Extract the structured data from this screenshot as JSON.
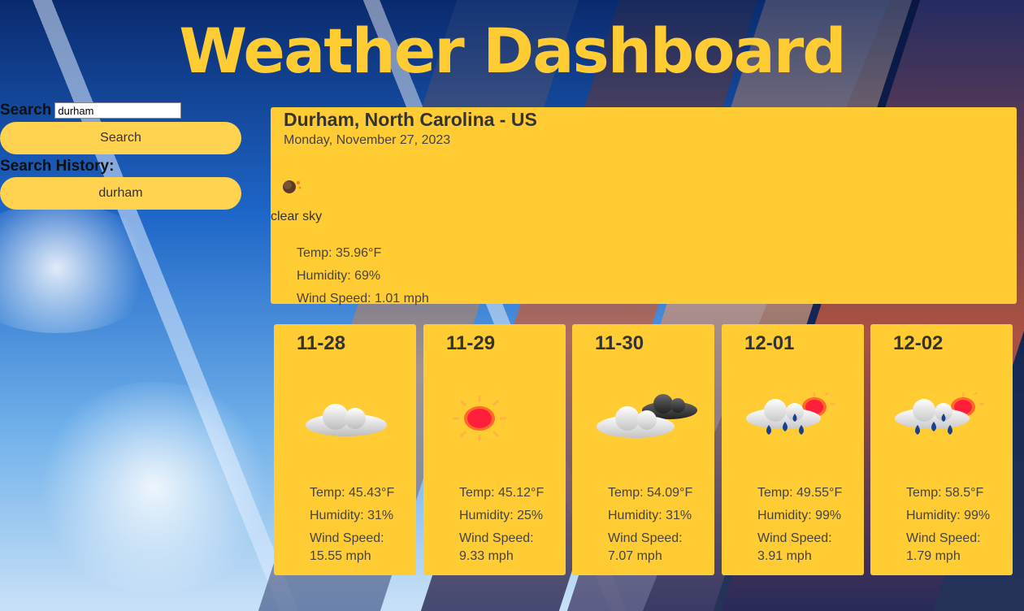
{
  "header": {
    "title": "Weather Dashboard"
  },
  "sidebar": {
    "search_label": "Search",
    "search_value": "durham",
    "search_button": "Search",
    "history_label": "Search History:",
    "history": [
      "durham"
    ]
  },
  "current": {
    "location": "Durham, North Carolina - US",
    "date": "Monday, November 27, 2023",
    "icon": "clear-night-icon",
    "description": "clear sky",
    "temp": "Temp: 35.96°F",
    "humidity": "Humidity: 69%",
    "wind": "Wind Speed: 1.01 mph"
  },
  "forecast": [
    {
      "day": "11-28",
      "icon": "cloud-icon",
      "temp": "Temp: 45.43°F",
      "humidity": "Humidity: 31%",
      "wind_label": "Wind Speed:",
      "wind_value": "15.55 mph"
    },
    {
      "day": "11-29",
      "icon": "sun-icon",
      "temp": "Temp: 45.12°F",
      "humidity": "Humidity: 25%",
      "wind_label": "Wind Speed:",
      "wind_value": "9.33 mph"
    },
    {
      "day": "11-30",
      "icon": "broken-clouds-icon",
      "temp": "Temp: 54.09°F",
      "humidity": "Humidity: 31%",
      "wind_label": "Wind Speed:",
      "wind_value": "7.07 mph"
    },
    {
      "day": "12-01",
      "icon": "rain-sun-icon",
      "temp": "Temp: 49.55°F",
      "humidity": "Humidity: 99%",
      "wind_label": "Wind Speed:",
      "wind_value": "3.91 mph"
    },
    {
      "day": "12-02",
      "icon": "rain-sun-icon",
      "temp": "Temp: 58.5°F",
      "humidity": "Humidity: 99%",
      "wind_label": "Wind Speed:",
      "wind_value": "1.79 mph"
    }
  ],
  "colors": {
    "accent": "#ffcc33",
    "button": "#ffd24f",
    "title": "#ffcc33"
  }
}
